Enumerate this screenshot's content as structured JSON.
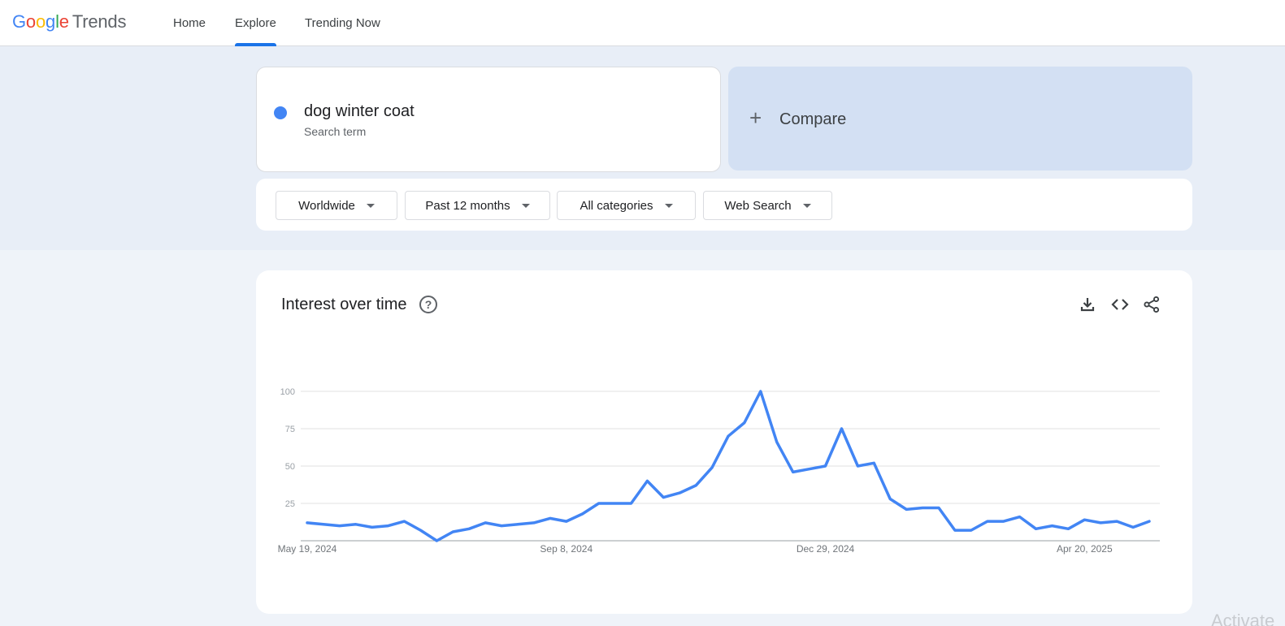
{
  "header": {
    "logo_google": [
      "G",
      "o",
      "o",
      "g",
      "l",
      "e"
    ],
    "logo_product": "Trends",
    "nav": [
      {
        "label": "Home",
        "active": false
      },
      {
        "label": "Explore",
        "active": true
      },
      {
        "label": "Trending Now",
        "active": false
      }
    ]
  },
  "search": {
    "term": "dog winter coat",
    "term_type": "Search term",
    "term_color": "#4285f4",
    "compare_label": "Compare"
  },
  "filters": [
    "Worldwide",
    "Past 12 months",
    "All categories",
    "Web Search"
  ],
  "card": {
    "title": "Interest over time",
    "tools": [
      "download-icon",
      "embed-code-icon",
      "share-icon"
    ]
  },
  "chart_data": {
    "type": "line",
    "series": [
      {
        "color": "#4285f4",
        "values": [
          12,
          11,
          10,
          11,
          9,
          10,
          13,
          7,
          0,
          6,
          8,
          12,
          10,
          11,
          12,
          15,
          13,
          18,
          25,
          25,
          25,
          40,
          29,
          32,
          37,
          49,
          70,
          79,
          100,
          66,
          46,
          48,
          50,
          75,
          50,
          52,
          28,
          21,
          22,
          22,
          7,
          7,
          13,
          13,
          16,
          8,
          10,
          8,
          14,
          12,
          13,
          9,
          13
        ]
      }
    ],
    "y_ticks": [
      "100",
      "75",
      "50",
      "25"
    ],
    "ylim": [
      0,
      100
    ],
    "x_ticks": [
      {
        "label": "May 19, 2024",
        "index": 0
      },
      {
        "label": "Sep 8, 2024",
        "index": 16
      },
      {
        "label": "Dec 29, 2024",
        "index": 32
      },
      {
        "label": "Apr 20, 2025",
        "index": 48
      }
    ],
    "grid": true
  }
}
